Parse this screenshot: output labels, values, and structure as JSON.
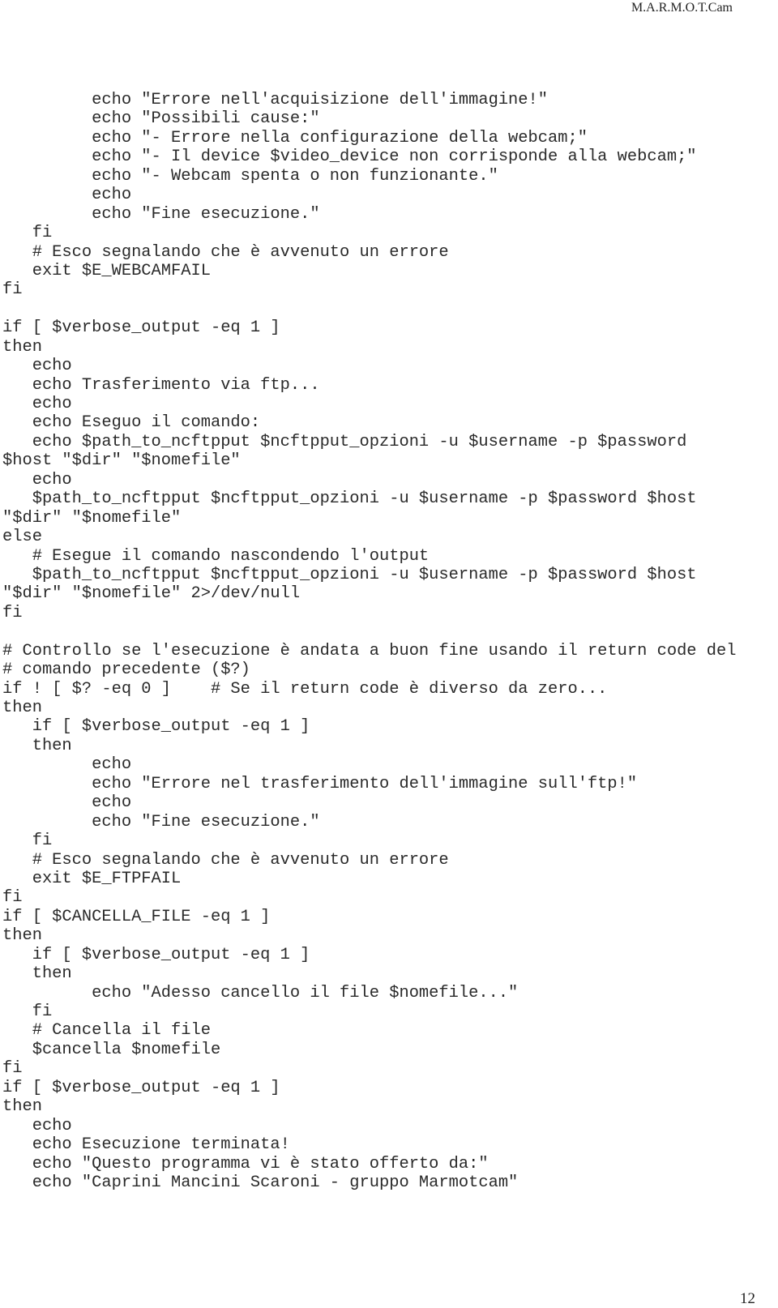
{
  "header": {
    "title": "M.A.R.M.O.T.Cam"
  },
  "page_number": "12",
  "code_lines": [
    "         echo \"Errore nell'acquisizione dell'immagine!\"",
    "         echo \"Possibili cause:\"",
    "         echo \"- Errore nella configurazione della webcam;\"",
    "         echo \"- Il device $video_device non corrisponde alla webcam;\"",
    "         echo \"- Webcam spenta o non funzionante.\"",
    "         echo",
    "         echo \"Fine esecuzione.\"",
    "   fi",
    "   # Esco segnalando che è avvenuto un errore",
    "   exit $E_WEBCAMFAIL",
    "fi",
    "",
    "if [ $verbose_output -eq 1 ]",
    "then",
    "   echo",
    "   echo Trasferimento via ftp...",
    "   echo",
    "   echo Eseguo il comando:",
    "   echo $path_to_ncftpput $ncftpput_opzioni -u $username -p $password",
    "$host \"$dir\" \"$nomefile\"",
    "   echo",
    "   $path_to_ncftpput $ncftpput_opzioni -u $username -p $password $host",
    "\"$dir\" \"$nomefile\"",
    "else",
    "   # Esegue il comando nascondendo l'output",
    "   $path_to_ncftpput $ncftpput_opzioni -u $username -p $password $host",
    "\"$dir\" \"$nomefile\" 2>/dev/null",
    "fi",
    "",
    "# Controllo se l'esecuzione è andata a buon fine usando il return code del",
    "# comando precedente ($?)",
    "if ! [ $? -eq 0 ]    # Se il return code è diverso da zero...",
    "then",
    "   if [ $verbose_output -eq 1 ]",
    "   then",
    "         echo",
    "         echo \"Errore nel trasferimento dell'immagine sull'ftp!\"",
    "         echo",
    "         echo \"Fine esecuzione.\"",
    "   fi",
    "   # Esco segnalando che è avvenuto un errore",
    "   exit $E_FTPFAIL",
    "fi",
    "if [ $CANCELLA_FILE -eq 1 ]",
    "then",
    "   if [ $verbose_output -eq 1 ]",
    "   then",
    "         echo \"Adesso cancello il file $nomefile...\"",
    "   fi",
    "   # Cancella il file",
    "   $cancella $nomefile",
    "fi",
    "if [ $verbose_output -eq 1 ]",
    "then",
    "   echo",
    "   echo Esecuzione terminata!",
    "   echo \"Questo programma vi è stato offerto da:\"",
    "   echo \"Caprini Mancini Scaroni - gruppo Marmotcam\""
  ]
}
